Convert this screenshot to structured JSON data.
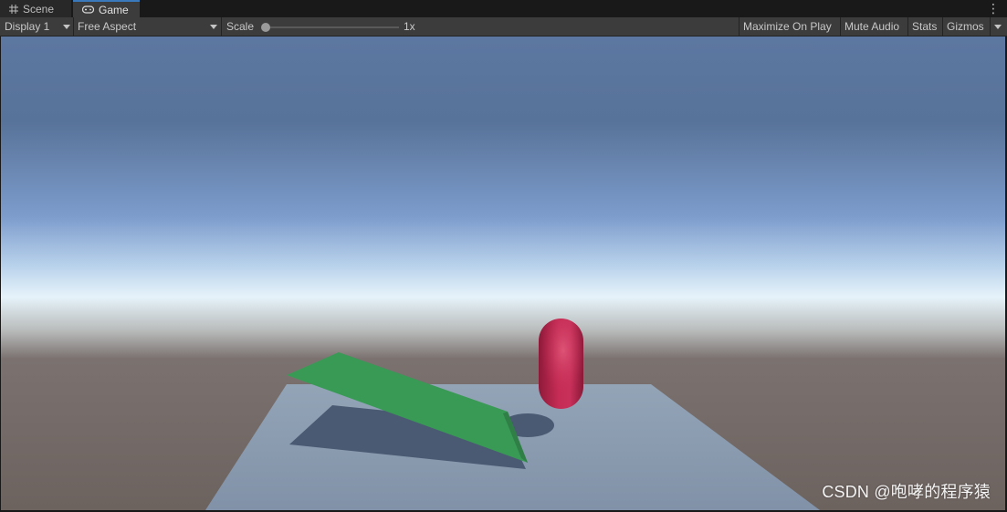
{
  "tabs": [
    {
      "label": "Scene",
      "icon": "grid-icon",
      "active": false
    },
    {
      "label": "Game",
      "icon": "gamepad-icon",
      "active": true
    }
  ],
  "toolbar": {
    "display": "Display 1",
    "aspect": "Free Aspect",
    "scale_label": "Scale",
    "scale_value": "1x",
    "maximize": "Maximize On Play",
    "mute": "Mute Audio",
    "stats": "Stats",
    "gizmos": "Gizmos"
  },
  "scene_objects": [
    "ground-plane",
    "green-ramp",
    "red-capsule"
  ],
  "watermark": "CSDN @咆哮的程序猿",
  "colors": {
    "ground": "#8a9ab0",
    "ramp": "#3a9a58",
    "capsule": "#c0284e",
    "horizon": "#6e6661",
    "sky_top": "#5a759e"
  }
}
